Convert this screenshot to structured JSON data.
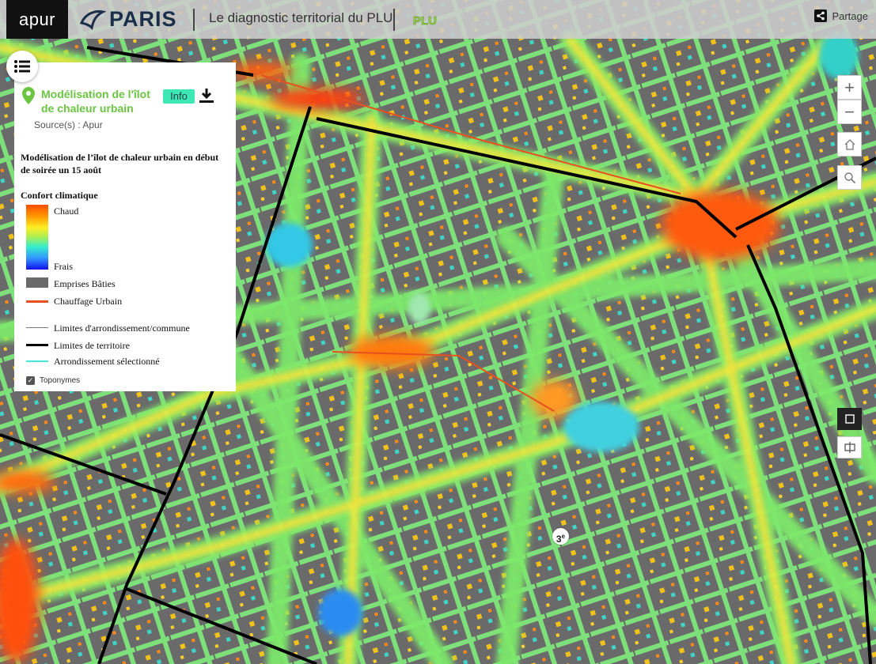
{
  "header": {
    "brand": "apur",
    "city": "PARIS",
    "site_title": "Le diagnostic territorial du PLU",
    "plu_badge": "PLU",
    "share_label": "Partage"
  },
  "layer": {
    "title": "Modélisation de l'îlot de chaleur urbain",
    "info_label": "Info",
    "source": "Source(s) : Apur",
    "description": "Modélisation de l’îlot de chaleur urbain en début de soirée un 15 août"
  },
  "legend": {
    "heading": "Confort climatique",
    "hot_label": "Chaud",
    "cold_label": "Frais",
    "buildings_label": "Emprises Bâties",
    "heating_label": "Chauffage Urbain",
    "district_limits_label": "Limites d'arrondissement/commune",
    "territory_limits_label": "Limites de territoire",
    "selected_district_label": "Arrondissement sélectionné",
    "toponyms_label": "Toponymes",
    "toponyms_checked": true
  },
  "map": {
    "district_label": "3",
    "district_label_suffix": "e",
    "colors": {
      "buildings": "#6a6a6a",
      "hot": "#ff4d00",
      "warm": "#ffee22",
      "mild": "#aaee55",
      "cool": "#33eecc",
      "cold": "#1111ee",
      "heating_network": "#e8501e",
      "territory_limit": "#000000",
      "selected_district": "#44e8d8"
    }
  },
  "controls": {
    "zoom_in": "+",
    "zoom_out": "−"
  }
}
